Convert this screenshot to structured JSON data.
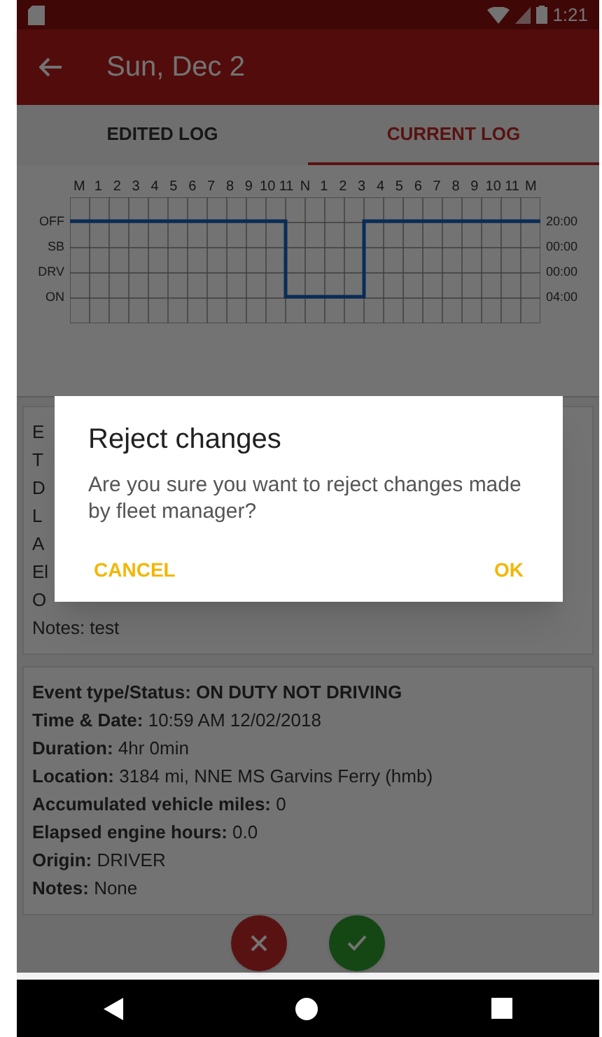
{
  "status_bar": {
    "time": "1:21"
  },
  "app_bar": {
    "title": "Sun, Dec 2"
  },
  "tabs": [
    {
      "label": "EDITED LOG",
      "selected": false
    },
    {
      "label": "CURRENT LOG",
      "selected": true
    }
  ],
  "log_graph": {
    "hours": [
      "M",
      "1",
      "2",
      "3",
      "4",
      "5",
      "6",
      "7",
      "8",
      "9",
      "10",
      "11",
      "N",
      "1",
      "2",
      "3",
      "4",
      "5",
      "6",
      "7",
      "8",
      "9",
      "10",
      "11",
      "M"
    ],
    "rows": [
      {
        "status": "OFF",
        "total": "20:00"
      },
      {
        "status": "SB",
        "total": "00:00"
      },
      {
        "status": "DRV",
        "total": "00:00"
      },
      {
        "status": "ON",
        "total": "04:00"
      }
    ]
  },
  "event_cards": [
    {
      "lines": [
        "E",
        "T",
        "D",
        "L",
        "A",
        "El",
        "O",
        "Notes: test"
      ]
    },
    {
      "lines": [
        "**Event type/Status:** **ON DUTY NOT DRIVING**",
        "**Time & Date:** 10:59 AM 12/02/2018",
        "**Duration:** 4hr 0min",
        "**Location:** 3184 mi, NNE MS Garvins Ferry (hmb)",
        "**Accumulated vehicle miles:** 0",
        "**Elapsed engine hours:** 0.0",
        "**Origin:** DRIVER",
        "**Notes:** None"
      ]
    }
  ],
  "dialog": {
    "title": "Reject changes",
    "message": "Are you sure you want to reject changes made by fleet manager?",
    "buttons": [
      "CANCEL",
      "OK"
    ]
  }
}
